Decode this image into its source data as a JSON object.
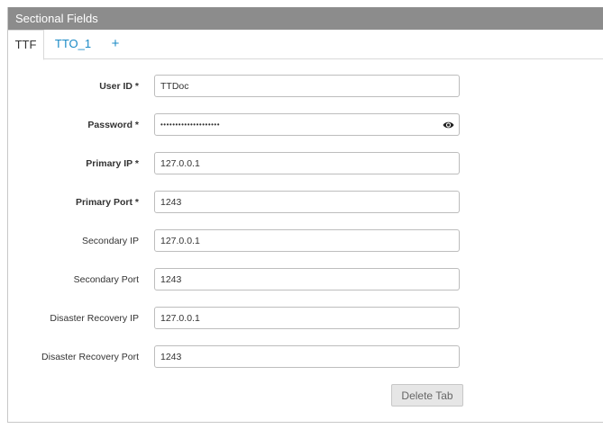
{
  "panel": {
    "title": "Sectional Fields"
  },
  "tabs": [
    {
      "label": "TTF",
      "active": true
    },
    {
      "label": "TTO_1",
      "active": false
    },
    {
      "label": "+",
      "active": false
    }
  ],
  "form": {
    "user_id": {
      "label": "User ID *",
      "value": "TTDoc",
      "required": true
    },
    "password": {
      "label": "Password *",
      "value": "••••••••••••••••••••",
      "required": true
    },
    "primary_ip": {
      "label": "Primary IP *",
      "value": "127.0.0.1",
      "required": true
    },
    "primary_port": {
      "label": "Primary Port *",
      "value": "1243",
      "required": true
    },
    "secondary_ip": {
      "label": "Secondary IP",
      "value": "127.0.0.1",
      "required": false
    },
    "secondary_port": {
      "label": "Secondary Port",
      "value": "1243",
      "required": false
    },
    "dr_ip": {
      "label": "Disaster Recovery IP",
      "value": "127.0.0.1",
      "required": false
    },
    "dr_port": {
      "label": "Disaster Recovery Port",
      "value": "1243",
      "required": false
    }
  },
  "actions": {
    "delete_tab_label": "Delete Tab"
  },
  "icons": {
    "password_toggle": "eye-icon"
  },
  "colors": {
    "header_bg": "#8c8c8c",
    "tab_link": "#1a8ac6"
  }
}
